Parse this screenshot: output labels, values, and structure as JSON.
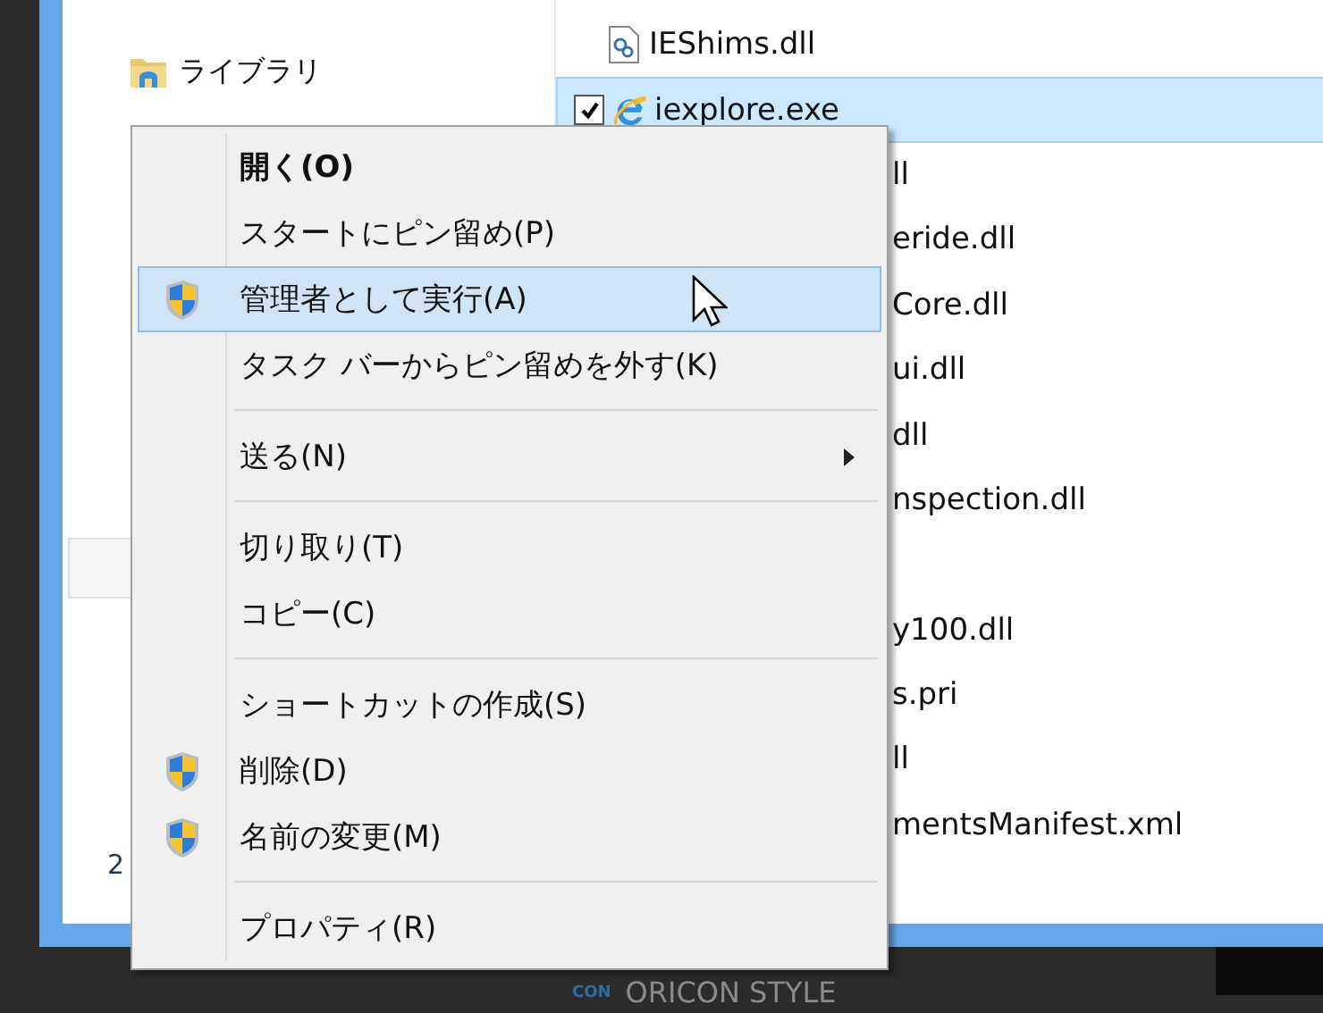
{
  "navigation": {
    "items": [
      {
        "label": "ライブラリ",
        "kind": "folder"
      }
    ],
    "status_text": "2"
  },
  "files": [
    {
      "name": "IEShims.dll",
      "kind": "dll",
      "selected": false,
      "checked": false
    },
    {
      "name": "iexplore.exe",
      "kind": "browser",
      "selected": true,
      "checked": true
    },
    {
      "name": "ll",
      "kind": "partial",
      "selected": false,
      "checked": false
    },
    {
      "name": "eride.dll",
      "kind": "partial",
      "selected": false,
      "checked": false
    },
    {
      "name": "Core.dll",
      "kind": "partial",
      "selected": false,
      "checked": false
    },
    {
      "name": "ui.dll",
      "kind": "partial",
      "selected": false,
      "checked": false
    },
    {
      "name": "dll",
      "kind": "partial",
      "selected": false,
      "checked": false
    },
    {
      "name": "nspection.dll",
      "kind": "partial",
      "selected": false,
      "checked": false
    },
    {
      "kind": "covered"
    },
    {
      "name": "y100.dll",
      "kind": "partial",
      "selected": false,
      "checked": false
    },
    {
      "name": "s.pri",
      "kind": "partial",
      "selected": false,
      "checked": false
    },
    {
      "name": "ll",
      "kind": "partial",
      "selected": false,
      "checked": false
    },
    {
      "name": "mentsManifest.xml",
      "kind": "partial",
      "selected": false,
      "checked": false
    }
  ],
  "context_menu": [
    {
      "kind": "item",
      "label": "開く(O)",
      "bold": true,
      "shield": false,
      "selected": false,
      "submenu": false
    },
    {
      "kind": "item",
      "label": "スタートにピン留め(P)",
      "bold": false,
      "shield": false,
      "selected": false,
      "submenu": false
    },
    {
      "kind": "item",
      "label": "管理者として実行(A)",
      "bold": false,
      "shield": true,
      "selected": true,
      "submenu": false
    },
    {
      "kind": "item",
      "label": "タスク バーからピン留めを外す(K)",
      "bold": false,
      "shield": false,
      "selected": false,
      "submenu": false
    },
    {
      "kind": "separator"
    },
    {
      "kind": "item",
      "label": "送る(N)",
      "bold": false,
      "shield": false,
      "selected": false,
      "submenu": true
    },
    {
      "kind": "separator"
    },
    {
      "kind": "item",
      "label": "切り取り(T)",
      "bold": false,
      "shield": false,
      "selected": false,
      "submenu": false
    },
    {
      "kind": "item",
      "label": "コピー(C)",
      "bold": false,
      "shield": false,
      "selected": false,
      "submenu": false
    },
    {
      "kind": "separator"
    },
    {
      "kind": "item",
      "label": "ショートカットの作成(S)",
      "bold": false,
      "shield": false,
      "selected": false,
      "submenu": false
    },
    {
      "kind": "item",
      "label": "削除(D)",
      "bold": false,
      "shield": true,
      "selected": false,
      "submenu": false
    },
    {
      "kind": "item",
      "label": "名前の変更(M)",
      "bold": false,
      "shield": true,
      "selected": false,
      "submenu": false
    },
    {
      "kind": "separator"
    },
    {
      "kind": "item",
      "label": "プロパティ(R)",
      "bold": false,
      "shield": false,
      "selected": false,
      "submenu": false
    }
  ],
  "taskbar": {
    "logo_text": "CON",
    "caption": "ORICON STYLE"
  }
}
